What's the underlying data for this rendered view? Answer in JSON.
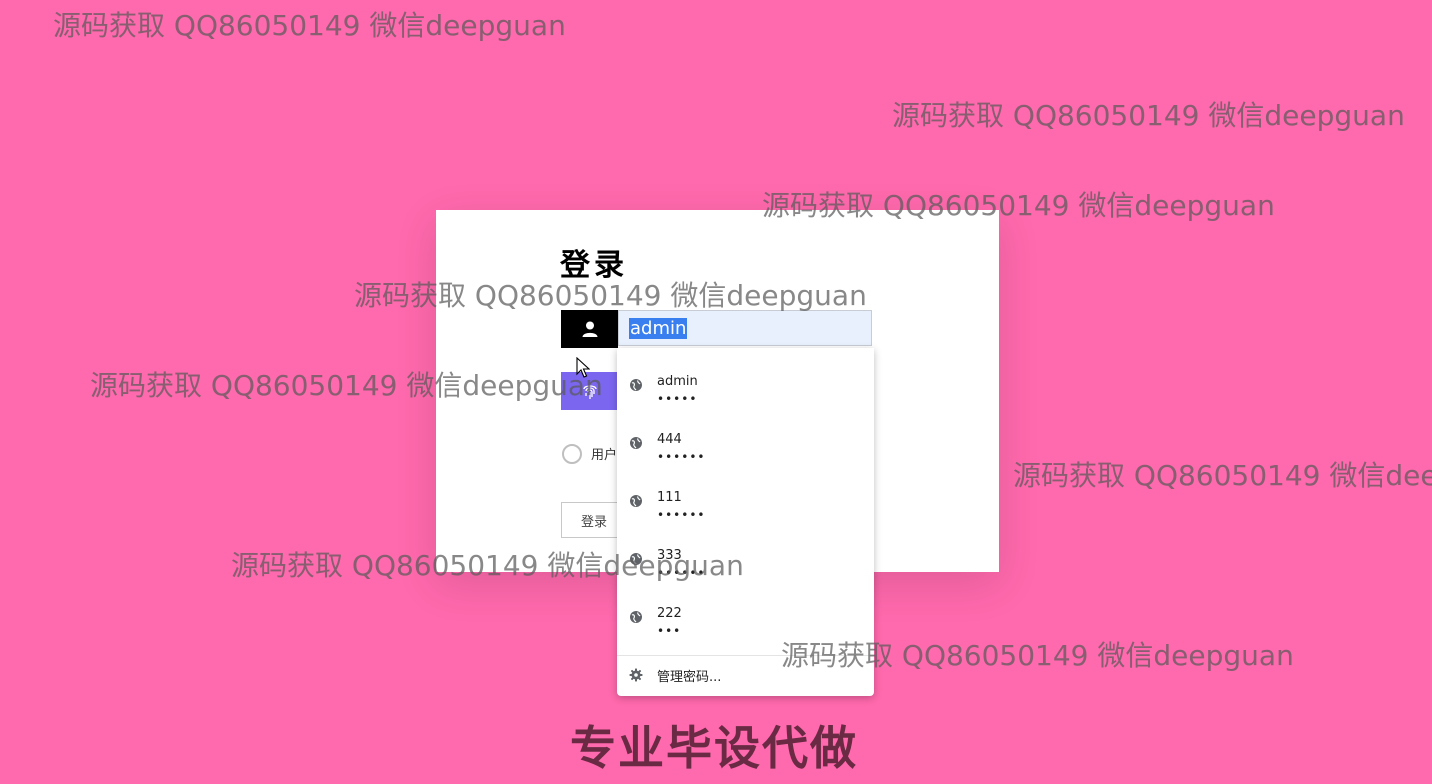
{
  "login": {
    "title": "登录",
    "username_value": "admin",
    "role_label": "用户",
    "login_button": "登录"
  },
  "autofill": {
    "items": [
      {
        "username": "admin",
        "password_mask": "•••••"
      },
      {
        "username": "444",
        "password_mask": "••••••"
      },
      {
        "username": "111",
        "password_mask": "••••••"
      },
      {
        "username": "333",
        "password_mask": "••••••"
      },
      {
        "username": "222",
        "password_mask": "•••"
      }
    ],
    "manage_label": "管理密码..."
  },
  "watermark_text": "源码获取 QQ86050149 微信deepguan",
  "footer_banner": "专业毕设代做",
  "colors": {
    "background": "#ff69ad",
    "user_addon": "#000000",
    "password_addon": "#7b66f0",
    "autofill_bg": "#e8f0fe",
    "selection": "#3a7ff0"
  },
  "icons": {
    "user": "user-icon",
    "fingerprint": "fingerprint-icon",
    "globe": "globe-icon",
    "gear": "gear-icon"
  }
}
